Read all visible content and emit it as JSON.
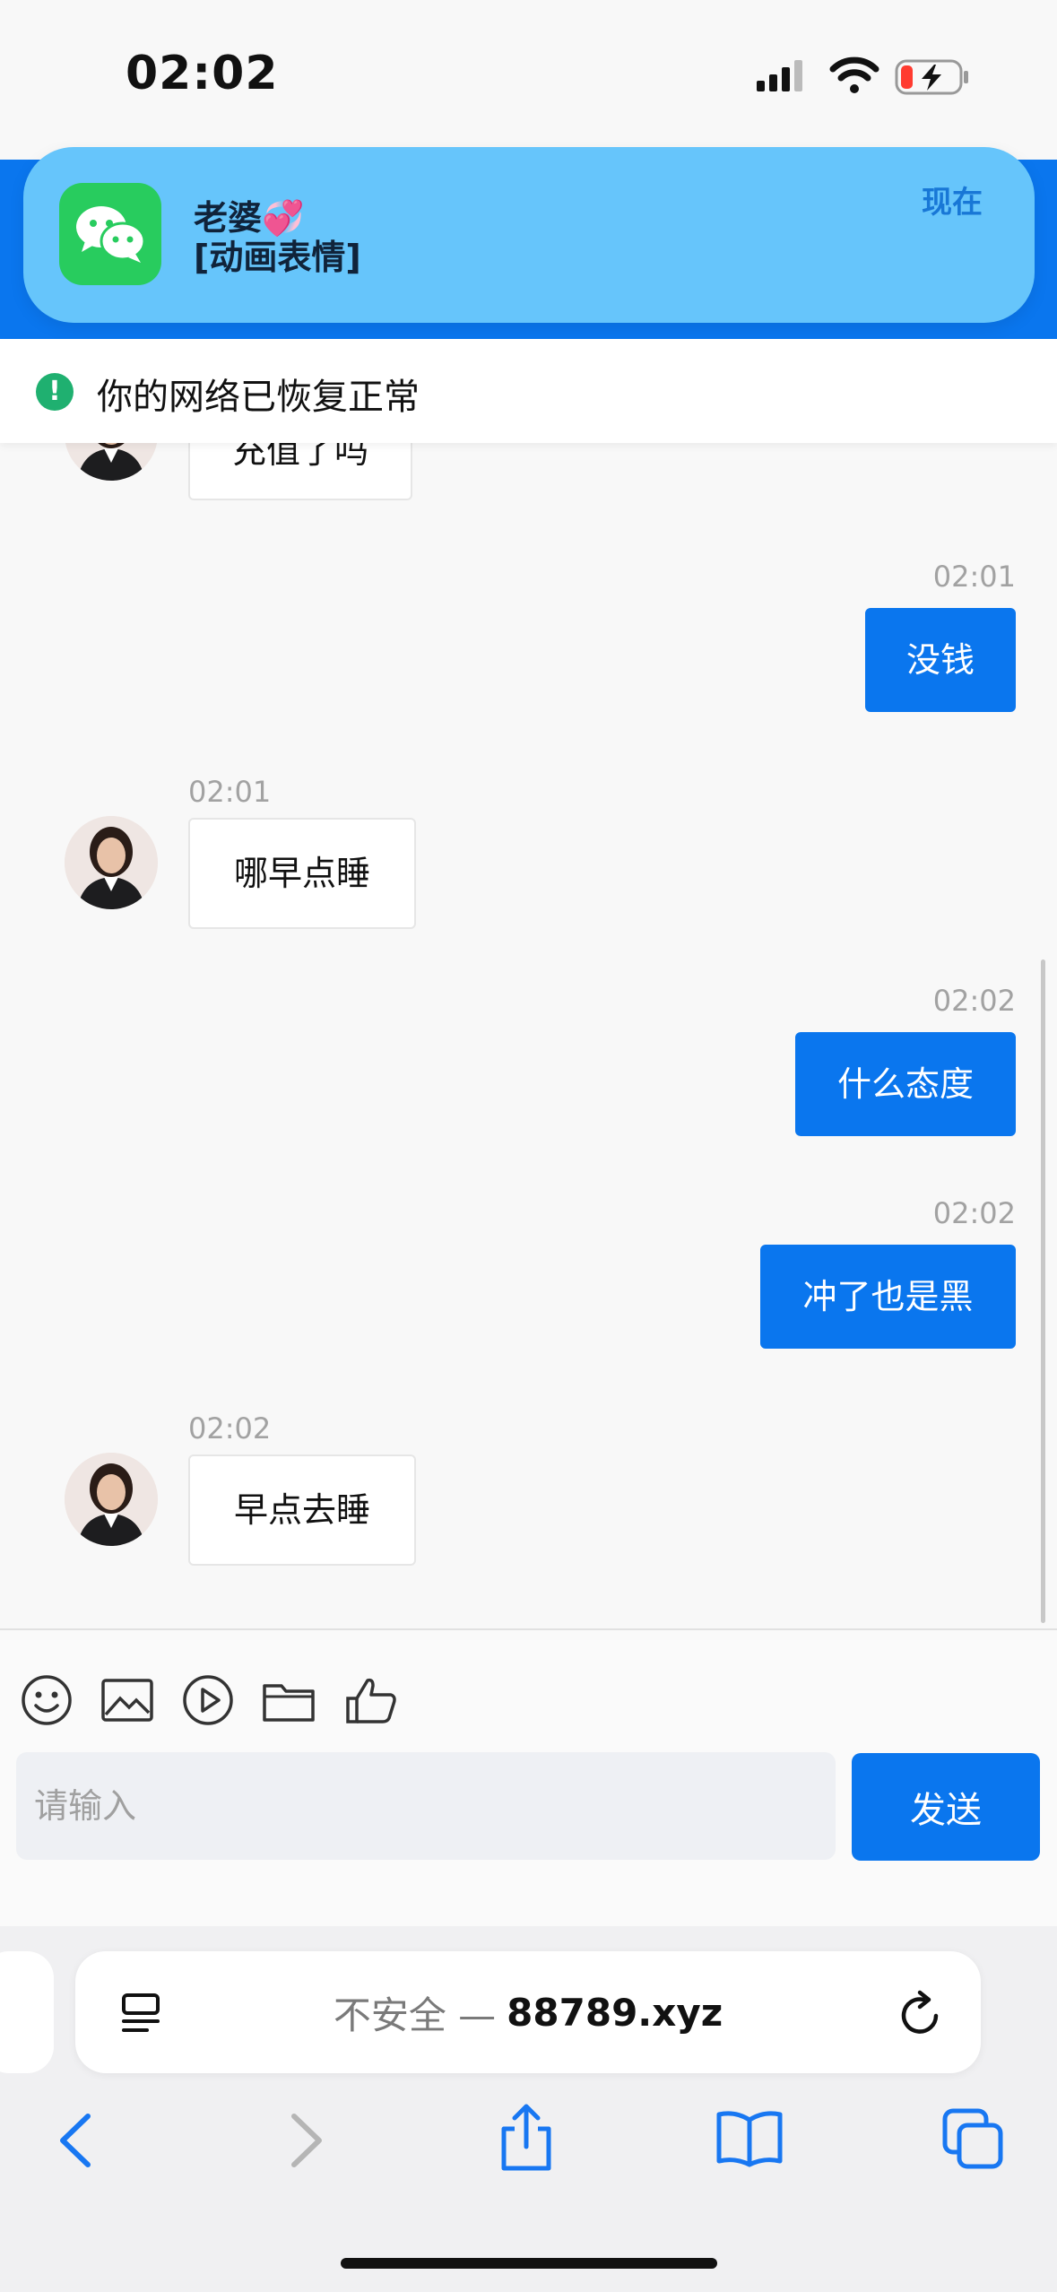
{
  "status": {
    "time": "02:02"
  },
  "notification": {
    "title": "老婆💞",
    "body": "[动画表情]",
    "time": "现在"
  },
  "network": {
    "message": "你的网络已恢复正常"
  },
  "chat": {
    "partial_message": "充值了吗",
    "messages": [
      {
        "side": "out",
        "time": "02:01",
        "text": "没钱"
      },
      {
        "side": "in",
        "time": "02:01",
        "text": "哪早点睡"
      },
      {
        "side": "out",
        "time": "02:02",
        "text": "什么态度"
      },
      {
        "side": "out",
        "time": "02:02",
        "text": "冲了也是黑"
      },
      {
        "side": "in",
        "time": "02:02",
        "text": "早点去睡"
      }
    ]
  },
  "composer": {
    "placeholder": "请输入",
    "send_label": "发送"
  },
  "browser": {
    "security": "不安全 —",
    "domain": "88789.xyz"
  },
  "colors": {
    "accent": "#0a76ee",
    "wechat": "#28cc5e",
    "banner": "#66c5fb"
  }
}
